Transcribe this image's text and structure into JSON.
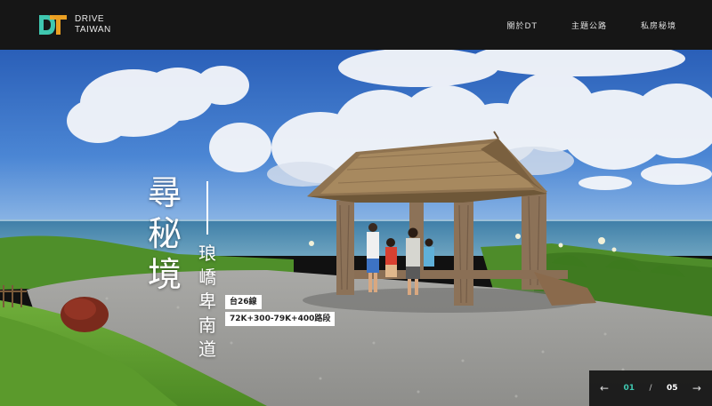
{
  "header": {
    "logo_mark": "DT",
    "logo_line1": "DRIVE",
    "logo_line2": "TAIWAN",
    "nav": [
      "關於DT",
      "主題公路",
      "私房秘境"
    ]
  },
  "hero": {
    "title_chars": [
      "尋",
      "秘",
      "境"
    ],
    "subtitle_chars": [
      "琅",
      "嶠",
      "卑",
      "南",
      "道"
    ],
    "road_tag": "台26線",
    "section_tag": "72K+300-79K+400路段"
  },
  "pager": {
    "prev_icon": "arrow-left-icon",
    "next_icon": "arrow-right-icon",
    "current": "01",
    "separator": "/",
    "total": "05"
  },
  "colors": {
    "accent": "#3fc7b0",
    "logo_orange": "#f5a623",
    "header_bg": "#161616"
  }
}
